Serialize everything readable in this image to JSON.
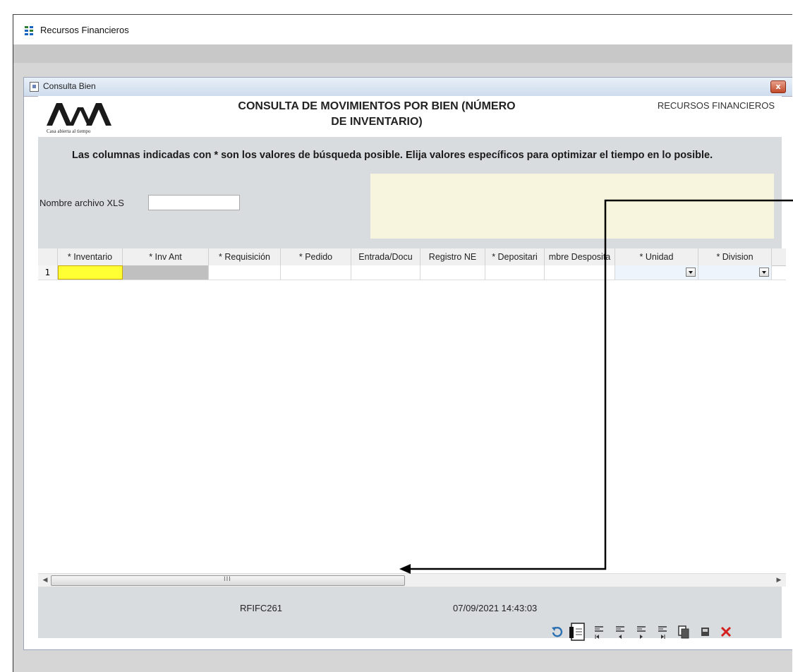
{
  "app": {
    "title": "Recursos Financieros"
  },
  "child_window": {
    "title": "Consulta Bien",
    "close_glyph": "x"
  },
  "header": {
    "logo_text": "Casa abierta al tiempo",
    "form_title": "CONSULTA DE MOVIMIENTOS POR BIEN (NÚMERO DE INVENTARIO)",
    "department": "RECURSOS FINANCIEROS"
  },
  "instructions": "Las columnas indicadas con * son los valores de búsqueda posible.  Elija valores específicos para optimizar el tiempo en lo posible.",
  "xls": {
    "label": "Nombre archivo XLS",
    "value": ""
  },
  "grid": {
    "columns": [
      "* Inventario",
      "* Inv Ant",
      "* Requisición",
      "* Pedido",
      "Entrada/Docu",
      "Registro NE",
      "* Depositari",
      "mbre Desposita",
      "* Unidad",
      "* Division"
    ],
    "row_number": "1",
    "colors": {
      "selected_cell": "#ffff33",
      "readonly_cell": "#c0c0c0",
      "unidad_cell": "#eef4fb"
    }
  },
  "scrollbar": {
    "grip": "III"
  },
  "footer": {
    "form_code": "RFIFC261",
    "datetime": "07/09/2021 14:43:03"
  },
  "toolbar": {
    "buttons": [
      "refresh-icon",
      "document-icon",
      "first-record-icon",
      "previous-record-icon",
      "next-record-icon",
      "last-record-icon",
      "copy-icon",
      "save-icon",
      "close-icon"
    ]
  },
  "annotation": {
    "color": "#000000"
  }
}
